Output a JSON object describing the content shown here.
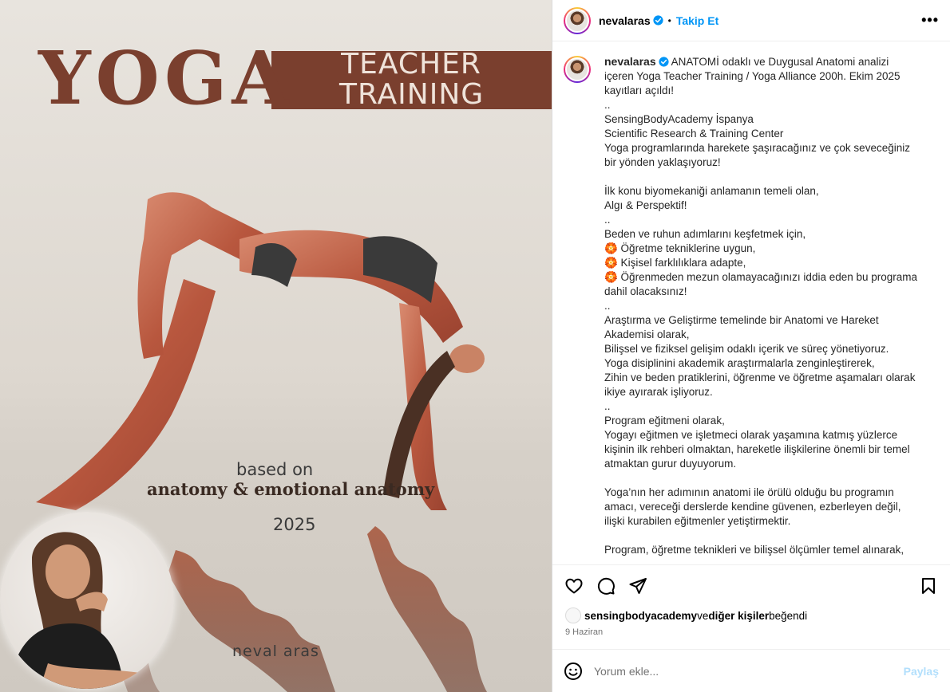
{
  "image": {
    "yoga": "YOGA",
    "teacher_line1": "TEACHER",
    "teacher_line2": "TRAINING",
    "based_on": "based on",
    "subtitle": "anatomy & emotional anatomy",
    "year": "2025",
    "author": "neval aras",
    "colors": {
      "brand": "#7a3f2e",
      "background": "#e4dfd8"
    }
  },
  "header": {
    "username": "nevalaras",
    "separator": "•",
    "follow_label": "Takip Et",
    "more_label": "•••"
  },
  "caption": {
    "username": "nevalaras",
    "first_line": " ANATOMİ odaklı ve Duygusal Anatomi analizi içeren Yoga Teacher Training / Yoga Alliance 200h. Ekim 2025 kayıtları açıldı!",
    "lines": [
      "..",
      "SensingBodyAcademy İspanya",
      "Scientific Research & Training Center",
      "Yoga programlarında harekete şaşıracağınız ve çok seveceğiniz bir yönden yaklaşıyoruz!",
      "",
      "İlk konu biyomekaniği anlamanın temeli olan,",
      "Algı & Perspektif!",
      "..",
      "Beden ve ruhun adımlarını keşfetmek için,",
      "🏵️ Öğretme tekniklerine uygun,",
      "🏵️ Kişisel farklılıklara adapte,",
      "🏵️ Öğrenmeden mezun olamayacağınızı iddia eden bu programa dahil olacaksınız!",
      "..",
      "Araştırma ve Geliştirme temelinde bir Anatomi ve Hareket Akademisi olarak,",
      "Bilişsel ve fiziksel gelişim odaklı içerik ve süreç yönetiyoruz.",
      "Yoga disiplinini akademik araştırmalarla zenginleştirerek,",
      "Zihin ve beden pratiklerini, öğrenme ve öğretme aşamaları olarak ikiye ayırarak işliyoruz.",
      "..",
      "Program eğitmeni olarak,",
      "Yogayı eğitmen ve işletmeci olarak yaşamına katmış yüzlerce kişinin ilk rehberi olmaktan, hareketle ilişkilerine önemli bir temel atmaktan gurur duyuyorum.",
      "",
      "Yoga’nın her adımının anatomi ile örülü olduğu bu programın amacı, vereceği derslerde kendine güvenen, ezberleyen değil, ilişki kurabilen eğitmenler yetiştirmektir.",
      "",
      "Program, öğretme teknikleri ve bilişsel ölçümler temel alınarak,"
    ]
  },
  "actions": {
    "like_icon": "heart-icon",
    "comment_icon": "comment-icon",
    "share_icon": "share-icon",
    "save_icon": "bookmark-icon"
  },
  "likes": {
    "first_liker": "sensingbodyacademy",
    "connector": " ve ",
    "others": "diğer kişiler",
    "suffix": " beğendi"
  },
  "date": "9 Haziran",
  "comment": {
    "placeholder": "Yorum ekle...",
    "post_label": "Paylaş"
  }
}
